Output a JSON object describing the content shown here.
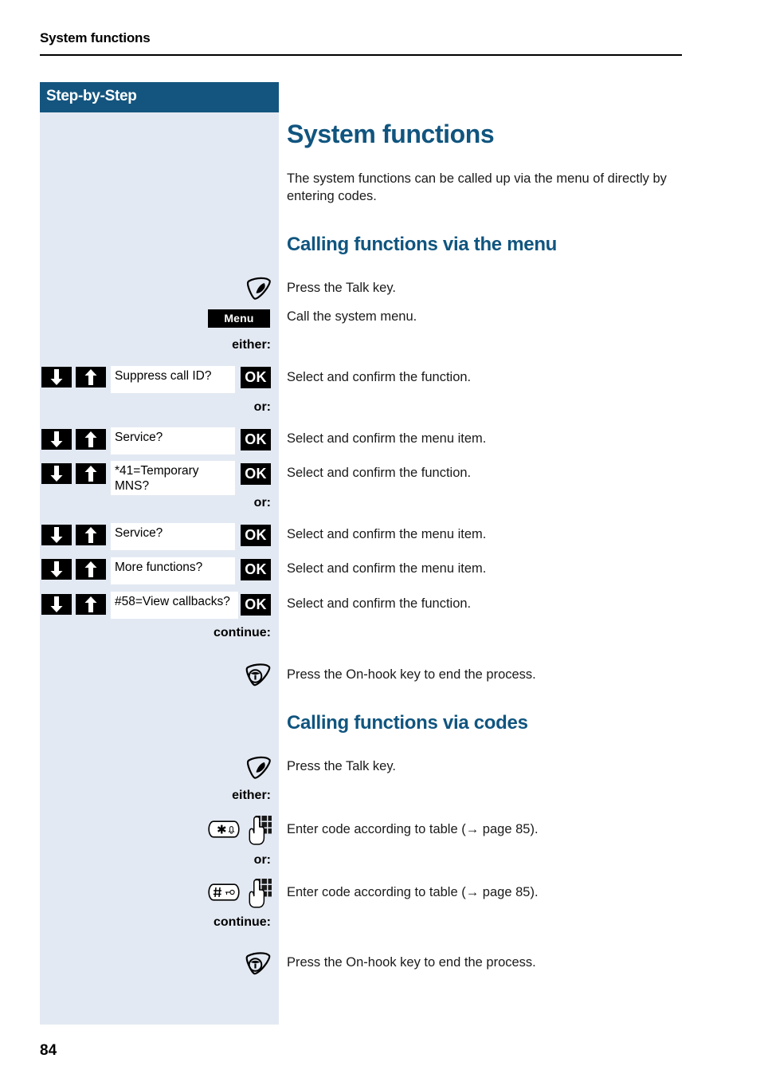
{
  "page": {
    "running_header": "System functions",
    "page_number": "84",
    "accent_blue": "#10557f",
    "sidebar_bg": "#e3e9f2",
    "sidebar_header_bg": "#14557f"
  },
  "sidebar": {
    "title": "Step-by-Step"
  },
  "main": {
    "title": "System functions",
    "intro": "The system functions can be called up via the menu of directly by entering codes.",
    "section_menu_title": "Calling functions via the menu",
    "section_codes_title": "Calling functions via codes"
  },
  "steps": {
    "talk_key_1": "Press the Talk key.",
    "menu_button": "Menu",
    "call_system_menu": "Call the system menu.",
    "either_1": "either:",
    "or_1": "or:",
    "or_2": "or:",
    "continue_1": "continue:",
    "either_2": "either:",
    "or_3": "or:",
    "continue_2": "continue:",
    "on_hook_1": "Press the On-hook key to end the process.",
    "on_hook_2": "Press the On-hook key to end the process.",
    "talk_key_2": "Press the Talk key.",
    "enter_code_star": "Enter code according to table (→ page 85).",
    "enter_code_hash": "Enter code according to table (→ page 85)."
  },
  "ok_label": "OK",
  "rows": [
    {
      "display": "Suppress call ID?",
      "ok": "OK",
      "instruction": "Select and confirm the function."
    },
    {
      "display": "Service?",
      "ok": "OK",
      "instruction": "Select and confirm the menu item."
    },
    {
      "display": "*41=Temporary MNS?",
      "ok": "OK",
      "instruction": "Select and confirm the function."
    },
    {
      "display": "Service?",
      "ok": "OK",
      "instruction": "Select and confirm the menu item."
    },
    {
      "display": "More functions?",
      "ok": "OK",
      "instruction": "Select and confirm the menu item."
    },
    {
      "display": "#58=View callbacks?",
      "ok": "OK",
      "instruction": "Select and confirm the function."
    }
  ],
  "icons": {
    "talk_key": "talk-key-icon",
    "on_hook_key": "on-hook-key-icon",
    "star_key": "star-key-icon",
    "hash_key": "hash-key-icon",
    "keypad": "keypad-icon",
    "arrow_down": "arrow-down-icon",
    "arrow_up": "arrow-up-icon"
  }
}
